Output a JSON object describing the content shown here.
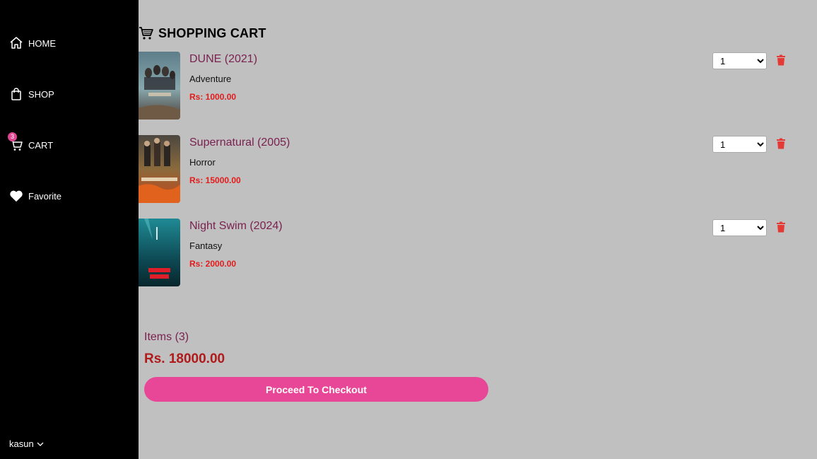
{
  "sidebar": {
    "items": [
      {
        "label": "HOME",
        "icon": "home-icon"
      },
      {
        "label": "SHOP",
        "icon": "shopping-bag-icon"
      },
      {
        "label": "CART",
        "icon": "cart-icon",
        "badge": "3"
      },
      {
        "label": "Favorite",
        "icon": "heart-icon"
      }
    ],
    "user": {
      "name": "kasun",
      "icon": "chevron-down-icon"
    }
  },
  "main": {
    "title": "SHOPPING CART",
    "title_icon": "cart-icon",
    "items": [
      {
        "title": "DUNE (2021)",
        "genre": "Adventure",
        "price": "Rs: 1000.00",
        "quantity": "1"
      },
      {
        "title": "Supernatural (2005)",
        "genre": "Horror",
        "price": "Rs: 15000.00",
        "quantity": "1"
      },
      {
        "title": "Night Swim (2024)",
        "genre": "Fantasy",
        "price": "Rs: 2000.00",
        "quantity": "1"
      }
    ],
    "summary": {
      "items_label": "Items (3)",
      "total": "Rs. 18000.00",
      "checkout_label": "Proceed To Checkout"
    }
  },
  "colors": {
    "sidebar_bg": "#000000",
    "page_bg": "#c0c0c0",
    "title_text": "#7a2150",
    "price_text": "#e31b1b",
    "accent": "#e84797",
    "delete_icon": "#e53935"
  }
}
